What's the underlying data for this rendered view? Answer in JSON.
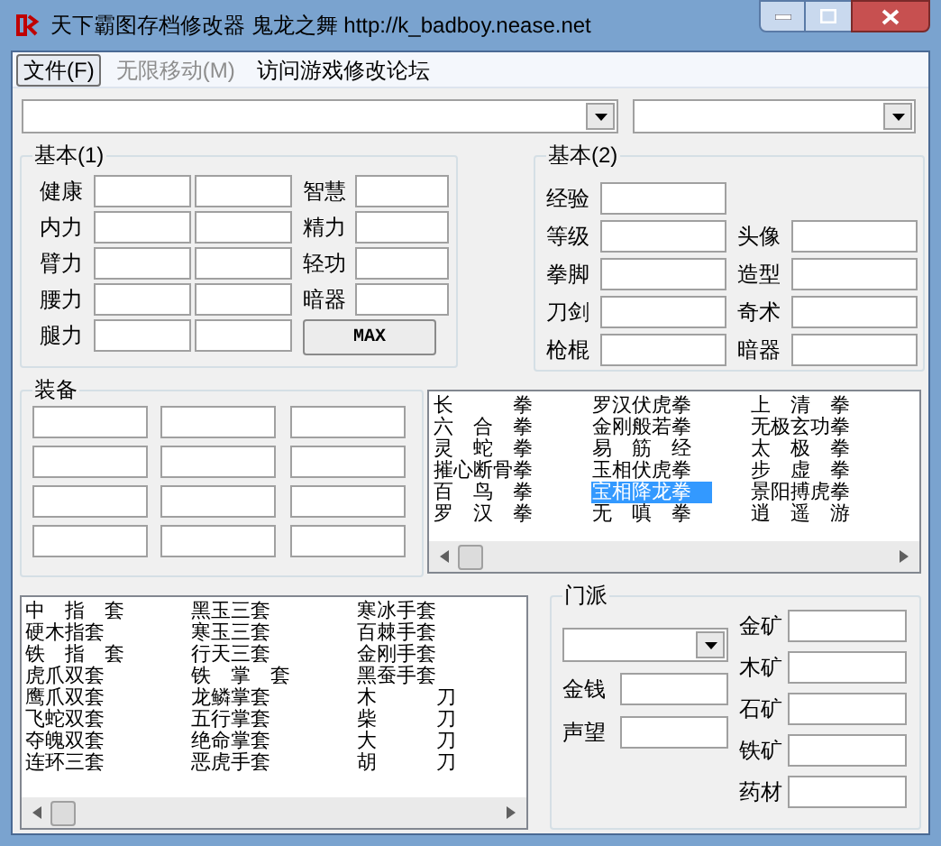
{
  "window": {
    "title": "天下霸图存档修改器 鬼龙之舞 http://k_badboy.nease.net"
  },
  "menu": [
    {
      "label": "文件(F)",
      "selected": true,
      "disabled": false
    },
    {
      "label": "无限移动(M)",
      "selected": false,
      "disabled": true
    },
    {
      "label": "访问游戏修改论坛",
      "selected": false,
      "disabled": false
    }
  ],
  "basic_1": {
    "title": "基本(1)",
    "left_labels": [
      "健康",
      "内力",
      "臂力",
      "腰力",
      "腿力"
    ],
    "right_labels": [
      "智慧",
      "精力",
      "轻功",
      "暗器"
    ],
    "max_button": "MAX"
  },
  "basic_2": {
    "title": "基本(2)",
    "left_labels": [
      "经验",
      "等级",
      "拳脚",
      "刀剑",
      "枪棍"
    ],
    "right_labels": [
      "头像",
      "造型",
      "奇术",
      "暗器"
    ]
  },
  "equipment": {
    "title": "装备"
  },
  "skills": [
    [
      {
        "label": "长　　　拳",
        "selected": false
      },
      {
        "label": "六　合　拳",
        "selected": false
      },
      {
        "label": "灵　蛇　拳",
        "selected": false
      },
      {
        "label": "摧心断骨拳",
        "selected": false
      },
      {
        "label": "百　鸟　拳",
        "selected": false
      },
      {
        "label": "罗　汉　拳",
        "selected": false
      }
    ],
    [
      {
        "label": "罗汉伏虎拳",
        "selected": false
      },
      {
        "label": "金刚般若拳",
        "selected": false
      },
      {
        "label": "易　筋　经",
        "selected": false
      },
      {
        "label": "玉相伏虎拳",
        "selected": false
      },
      {
        "label": "宝相降龙拳",
        "selected": true
      },
      {
        "label": "无　嗔　拳",
        "selected": false
      }
    ],
    [
      {
        "label": "上　清　拳",
        "selected": false
      },
      {
        "label": "无极玄功拳",
        "selected": false
      },
      {
        "label": "太　极　拳",
        "selected": false
      },
      {
        "label": "步　虚　拳",
        "selected": false
      },
      {
        "label": "景阳搏虎拳",
        "selected": false
      },
      {
        "label": "逍　遥　游",
        "selected": false
      }
    ]
  ],
  "items": [
    [
      "中　指　套",
      "硬木指套",
      "铁　指　套",
      "虎爪双套",
      "鹰爪双套",
      "飞蛇双套",
      "夺魄双套",
      "连环三套"
    ],
    [
      "黑玉三套",
      "寒玉三套",
      "行天三套",
      "铁　掌　套",
      "龙鳞掌套",
      "五行掌套",
      "绝命掌套",
      "恶虎手套"
    ],
    [
      "寒冰手套",
      "百棘手套",
      "金刚手套",
      "黑蚕手套",
      "木　　　刀",
      "柴　　　刀",
      "大　　　刀",
      "胡　　　刀"
    ]
  ],
  "faction": {
    "title": "门派",
    "left_labels": [
      "金钱",
      "声望"
    ],
    "right_labels": [
      "金矿",
      "木矿",
      "石矿",
      "铁矿",
      "药材"
    ]
  }
}
